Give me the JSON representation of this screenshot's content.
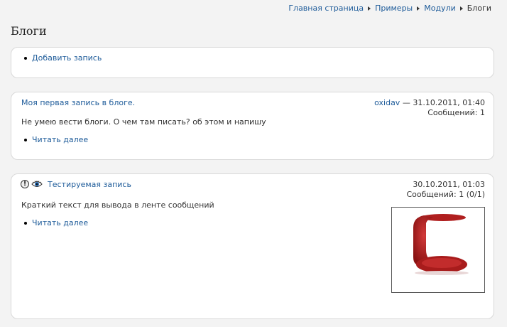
{
  "breadcrumb": {
    "items": [
      "Главная страница",
      "Примеры",
      "Модули"
    ],
    "current": "Блоги"
  },
  "page_title": "Блоги",
  "actions": {
    "add_post": "Добавить запись"
  },
  "posts": [
    {
      "title": "Моя первая запись в блоге.",
      "author": "oxidav",
      "date": " — 31.10.2011, 01:40",
      "messages": "Сообщений: 1",
      "text": "Не умею вести блоги. О чем там писать? об этом и напишу",
      "read_more": "Читать далее"
    },
    {
      "title": "Тестируемая запись",
      "date": "30.10.2011, 01:03",
      "messages": "Сообщений: 1 (0/1)",
      "text": "Краткий текст для вывода в ленте сообщений",
      "read_more": "Читать далее",
      "icons": [
        "warning-icon",
        "eye-icon"
      ],
      "warning_glyph": "!",
      "image": "red-chair-thumbnail"
    }
  ],
  "colors": {
    "link": "#1f5c9a",
    "background": "#f3f3f3",
    "chair": "#a81c1c"
  }
}
